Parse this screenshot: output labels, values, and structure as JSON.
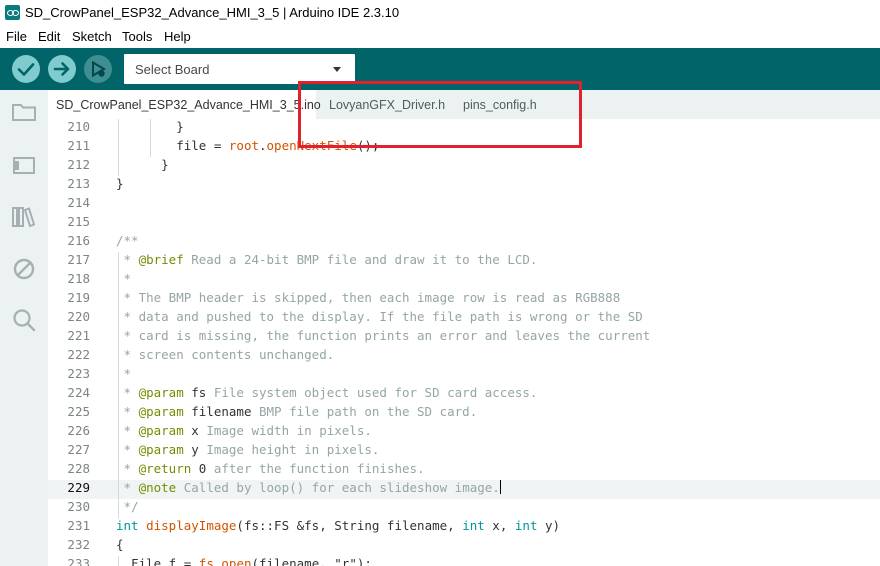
{
  "window": {
    "title": "SD_CrowPanel_ESP32_Advance_HMI_3_5 | Arduino IDE 2.3.10"
  },
  "menu": [
    "File",
    "Edit",
    "Sketch",
    "Tools",
    "Help"
  ],
  "toolbar": {
    "board_select": "Select Board"
  },
  "tabs": [
    "SD_CrowPanel_ESP32_Advance_HMI_3_5.ino",
    "LovyanGFX_Driver.h",
    "pins_config.h"
  ],
  "colors": {
    "toolbar": "#006468",
    "highlight": "#e2202e",
    "keyword": "#00979c",
    "comment": "#95a5a6"
  },
  "editor": {
    "lines": [
      {
        "n": "210",
        "parts": [
          [
            "",
            "        }"
          ]
        ]
      },
      {
        "n": "211",
        "parts": [
          [
            "",
            "        file = "
          ],
          [
            "fn",
            "root"
          ],
          [
            "",
            "."
          ],
          [
            "fn",
            "openNextFile"
          ],
          [
            "",
            "();"
          ]
        ]
      },
      {
        "n": "212",
        "parts": [
          [
            "",
            "      }"
          ]
        ]
      },
      {
        "n": "213",
        "parts": [
          [
            "",
            "}"
          ]
        ]
      },
      {
        "n": "214",
        "parts": [
          [
            "",
            ""
          ]
        ]
      },
      {
        "n": "215",
        "parts": [
          [
            "",
            ""
          ]
        ]
      },
      {
        "n": "216",
        "parts": [
          [
            "cm",
            "/**"
          ]
        ]
      },
      {
        "n": "217",
        "parts": [
          [
            "cm",
            " * "
          ],
          [
            "tag",
            "@brief"
          ],
          [
            "cm",
            " Read a 24-bit BMP file and draw it to the LCD."
          ]
        ]
      },
      {
        "n": "218",
        "parts": [
          [
            "cm",
            " *"
          ]
        ]
      },
      {
        "n": "219",
        "parts": [
          [
            "cm",
            " * The BMP header is skipped, then each image row is read as RGB888"
          ]
        ]
      },
      {
        "n": "220",
        "parts": [
          [
            "cm",
            " * data and pushed to the display. If the file path is wrong or the SD"
          ]
        ]
      },
      {
        "n": "221",
        "parts": [
          [
            "cm",
            " * card is missing, the function prints an error and leaves the current"
          ]
        ]
      },
      {
        "n": "222",
        "parts": [
          [
            "cm",
            " * screen contents unchanged."
          ]
        ]
      },
      {
        "n": "223",
        "parts": [
          [
            "cm",
            " *"
          ]
        ]
      },
      {
        "n": "224",
        "parts": [
          [
            "cm",
            " * "
          ],
          [
            "tag",
            "@param"
          ],
          [
            "",
            " fs"
          ],
          [
            "cm",
            " File system object used for SD card access."
          ]
        ]
      },
      {
        "n": "225",
        "parts": [
          [
            "cm",
            " * "
          ],
          [
            "tag",
            "@param"
          ],
          [
            "",
            " filename"
          ],
          [
            "cm",
            " BMP file path on the SD card."
          ]
        ]
      },
      {
        "n": "226",
        "parts": [
          [
            "cm",
            " * "
          ],
          [
            "tag",
            "@param"
          ],
          [
            "",
            " x"
          ],
          [
            "cm",
            " Image width in pixels."
          ]
        ]
      },
      {
        "n": "227",
        "parts": [
          [
            "cm",
            " * "
          ],
          [
            "tag",
            "@param"
          ],
          [
            "",
            " y"
          ],
          [
            "cm",
            " Image height in pixels."
          ]
        ]
      },
      {
        "n": "228",
        "parts": [
          [
            "cm",
            " * "
          ],
          [
            "tag",
            "@return"
          ],
          [
            "",
            " 0"
          ],
          [
            "cm",
            " after the function finishes."
          ]
        ]
      },
      {
        "n": "229",
        "parts": [
          [
            "cm",
            " * "
          ],
          [
            "tag",
            "@note"
          ],
          [
            "cm",
            " Called by loop() for each slideshow image."
          ]
        ],
        "current": true
      },
      {
        "n": "230",
        "parts": [
          [
            "cm",
            " */"
          ]
        ]
      },
      {
        "n": "231",
        "parts": [
          [
            "kw",
            "int"
          ],
          [
            "",
            " "
          ],
          [
            "fn",
            "displayImage"
          ],
          [
            "",
            "(fs::FS &fs, String filename, "
          ],
          [
            "kw",
            "int"
          ],
          [
            "",
            " x, "
          ],
          [
            "kw",
            "int"
          ],
          [
            "",
            " y)"
          ]
        ]
      },
      {
        "n": "232",
        "parts": [
          [
            "",
            "{"
          ]
        ]
      },
      {
        "n": "233",
        "parts": [
          [
            "",
            "  File f = "
          ],
          [
            "fn",
            "fs"
          ],
          [
            "",
            "."
          ],
          [
            "fn",
            "open"
          ],
          [
            "",
            "(filename, \"r\");"
          ]
        ]
      }
    ]
  }
}
